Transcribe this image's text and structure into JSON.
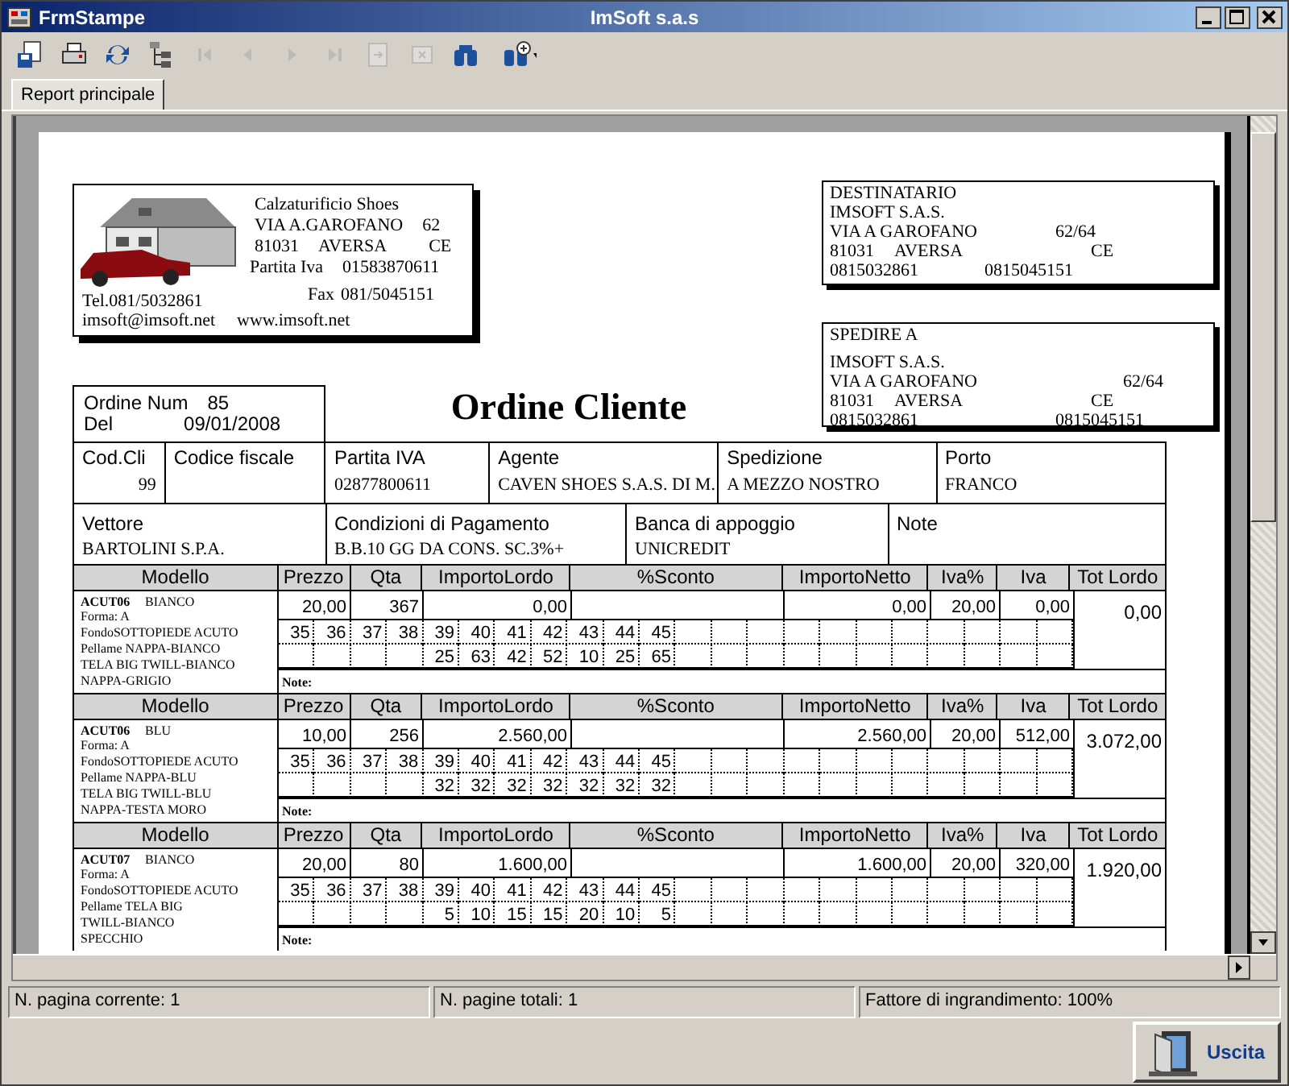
{
  "window": {
    "title": "FrmStampe",
    "caption": "ImSoft s.a.s"
  },
  "toolbar": [
    {
      "kind": "export",
      "disabled": false
    },
    {
      "kind": "print",
      "disabled": false
    },
    {
      "kind": "refresh",
      "disabled": false
    },
    {
      "kind": "tree",
      "disabled": false
    },
    {
      "kind": "first",
      "disabled": true
    },
    {
      "kind": "prev",
      "disabled": true
    },
    {
      "kind": "next",
      "disabled": true
    },
    {
      "kind": "last",
      "disabled": true
    },
    {
      "kind": "page",
      "disabled": true
    },
    {
      "kind": "stop",
      "disabled": true
    },
    {
      "kind": "find",
      "disabled": false
    },
    {
      "kind": "findmore",
      "disabled": false
    }
  ],
  "tabs": [
    {
      "label": "Report principale",
      "selected": true
    }
  ],
  "report": {
    "company": {
      "name": "Calzaturificio Shoes",
      "street": [
        "VIA A.GAROFANO",
        "62"
      ],
      "city": [
        "81031",
        "AVERSA",
        "CE"
      ],
      "vat": [
        "Partita Iva",
        "01583870611"
      ],
      "tel": "Tel.081/5032861",
      "fax": [
        "Fax",
        "081/5045151"
      ],
      "email": "imsoft@imsoft.net",
      "web": "www.imsoft.net"
    },
    "addresses": [
      {
        "kind": "recipient",
        "heading": "DESTINATARIO",
        "name": "IMSOFT S.A.S.",
        "street": "VIA A GAROFANO",
        "number": "62/64",
        "zip": "81031",
        "city": "AVERSA",
        "province": "CE",
        "phone": "0815032861",
        "fax": "0815045151"
      },
      {
        "kind": "ship_to",
        "heading": "SPEDIRE A",
        "name": "IMSOFT S.A.S.",
        "street": "VIA A GAROFANO",
        "number": "62/64",
        "zip": "81031",
        "city": "AVERSA",
        "province": "CE",
        "phone": "0815032861",
        "fax": "0815045151"
      }
    ],
    "title": "Ordine Cliente",
    "order": {
      "num_label": "Ordine Num",
      "num": "85",
      "date_label": "Del",
      "date": "09/01/2008"
    },
    "info_rows": [
      [
        {
          "label": "Cod.Cli",
          "value": "99"
        },
        {
          "label": "Codice fiscale"
        },
        {
          "label": "Partita IVA",
          "value": "02877800611"
        },
        {
          "label": "Agente",
          "value": "CAVEN SHOES S.A.S. DI M."
        },
        {
          "label": "Spedizione",
          "value": "A MEZZO NOSTRO"
        },
        {
          "label": "Porto",
          "value": "FRANCO"
        }
      ],
      [
        {
          "label": "Vettore",
          "value": "BARTOLINI S.P.A."
        },
        {
          "label": "Condizioni di Pagamento",
          "value": "B.B.10 GG DA CONS. SC.3%+"
        },
        {
          "label": "Banca di appoggio",
          "value": "UNICREDIT"
        },
        {
          "label": "Note"
        }
      ]
    ],
    "items": [
      {
        "header": [
          "Modello",
          "Prezzo",
          "Qta",
          "ImportoLordo",
          "%Sconto",
          "ImportoNetto",
          "Iva%",
          "Iva",
          "Tot Lordo"
        ],
        "code": "ACUT06",
        "variant": "BIANCO",
        "details": [
          "Forma: A",
          "FondoSOTTOPIEDE ACUTO",
          "Pellame NAPPA-BIANCO",
          "TELA BIG TWILL-BIANCO",
          "NAPPA-GRIGIO"
        ],
        "values": {
          "prezzo": "20,00",
          "qta": "367",
          "lordo": "0,00",
          "netto": "0,00",
          "iva_pct": "20,00",
          "iva": "0,00"
        },
        "total": "0,00",
        "sizes": [
          {
            "size": "35"
          },
          {
            "size": "36"
          },
          {
            "size": "37"
          },
          {
            "size": "38"
          },
          {
            "size": "39",
            "qty": "25"
          },
          {
            "size": "40",
            "qty": "63"
          },
          {
            "size": "41",
            "qty": "42"
          },
          {
            "size": "42",
            "qty": "52"
          },
          {
            "size": "43",
            "qty": "10"
          },
          {
            "size": "44",
            "qty": "25"
          },
          {
            "size": "45",
            "qty": "65"
          }
        ],
        "note_label": "Note:"
      },
      {
        "header": [
          "Modello",
          "Prezzo",
          "Qta",
          "ImportoLordo",
          "%Sconto",
          "ImportoNetto",
          "Iva%",
          "Iva",
          "Tot Lordo"
        ],
        "code": "ACUT06",
        "variant": "BLU",
        "details": [
          "Forma: A",
          "FondoSOTTOPIEDE ACUTO",
          "Pellame NAPPA-BLU",
          "TELA BIG TWILL-BLU",
          "NAPPA-TESTA MORO"
        ],
        "values": {
          "prezzo": "10,00",
          "qta": "256",
          "lordo": "2.560,00",
          "netto": "2.560,00",
          "iva_pct": "20,00",
          "iva": "512,00"
        },
        "total": "3.072,00",
        "sizes": [
          {
            "size": "35"
          },
          {
            "size": "36"
          },
          {
            "size": "37"
          },
          {
            "size": "38"
          },
          {
            "size": "39",
            "qty": "32"
          },
          {
            "size": "40",
            "qty": "32"
          },
          {
            "size": "41",
            "qty": "32"
          },
          {
            "size": "42",
            "qty": "32"
          },
          {
            "size": "43",
            "qty": "32"
          },
          {
            "size": "44",
            "qty": "32"
          },
          {
            "size": "45",
            "qty": "32"
          }
        ],
        "note_label": "Note:"
      },
      {
        "header": [
          "Modello",
          "Prezzo",
          "Qta",
          "ImportoLordo",
          "%Sconto",
          "ImportoNetto",
          "Iva%",
          "Iva",
          "Tot Lordo"
        ],
        "code": "ACUT07",
        "variant": "BIANCO",
        "details": [
          "Forma: A",
          "FondoSOTTOPIEDE ACUTO",
          "Pellame TELA BIG",
          "TWILL-BIANCO",
          "SPECCHIO"
        ],
        "values": {
          "prezzo": "20,00",
          "qta": "80",
          "lordo": "1.600,00",
          "netto": "1.600,00",
          "iva_pct": "20,00",
          "iva": "320,00"
        },
        "total": "1.920,00",
        "sizes": [
          {
            "size": "35"
          },
          {
            "size": "36"
          },
          {
            "size": "37"
          },
          {
            "size": "38"
          },
          {
            "size": "39",
            "qty": "5"
          },
          {
            "size": "40",
            "qty": "10"
          },
          {
            "size": "41",
            "qty": "15"
          },
          {
            "size": "42",
            "qty": "15"
          },
          {
            "size": "43",
            "qty": "20"
          },
          {
            "size": "44",
            "qty": "10"
          },
          {
            "size": "45",
            "qty": "5"
          }
        ],
        "note_label": "Note:"
      }
    ]
  },
  "status_bar": [
    "N. pagina corrente: 1",
    "N. pagine totali: 1",
    "Fattore di ingrandimento: 100%"
  ],
  "exit_button": {
    "label": "Uscita"
  }
}
